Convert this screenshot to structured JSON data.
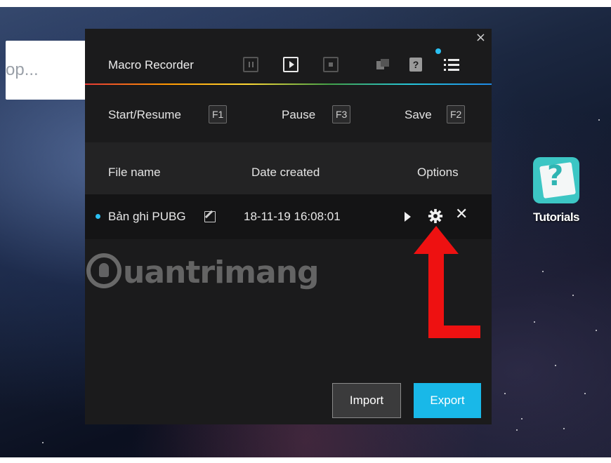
{
  "desktop": {
    "search_placeholder": "op...",
    "shortcut_label": "Tutorials",
    "shortcut_glyph": "?"
  },
  "recorder": {
    "title": "Macro Recorder",
    "close_glyph": "×",
    "help_glyph": "?",
    "hotkeys": [
      {
        "label": "Start/Resume",
        "key": "F1"
      },
      {
        "label": "Pause",
        "key": "F3"
      },
      {
        "label": "Save",
        "key": "F2"
      }
    ],
    "columns": {
      "file_name": "File name",
      "date_created": "Date created",
      "options": "Options"
    },
    "rows": [
      {
        "name": "Bản ghi PUBG",
        "date": "18-11-19 16:08:01"
      }
    ],
    "row_close_glyph": "✕",
    "import_label": "Import",
    "export_label": "Export"
  },
  "watermark": {
    "text": "uantrimang"
  },
  "colors": {
    "accent": "#19b8e8",
    "panel_bg": "#1b1b1c",
    "arrow": "#ee1111"
  }
}
